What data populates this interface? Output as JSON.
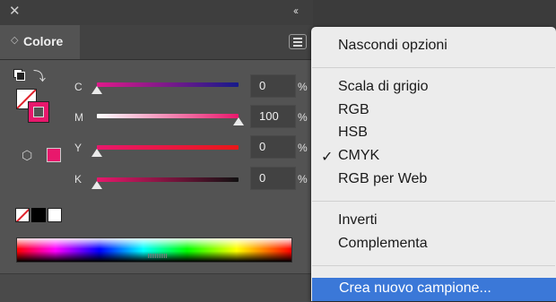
{
  "panel": {
    "title": "Colore",
    "sliders": [
      {
        "label": "C",
        "value": "0",
        "percent": 0,
        "unit": "%"
      },
      {
        "label": "M",
        "value": "100",
        "percent": 100,
        "unit": "%"
      },
      {
        "label": "Y",
        "value": "0",
        "percent": 0,
        "unit": "%"
      },
      {
        "label": "K",
        "value": "0",
        "percent": 0,
        "unit": "%"
      }
    ],
    "fill_color": "#e8186c"
  },
  "menu": {
    "items": {
      "hide_options": "Nascondi opzioni",
      "grayscale": "Scala di grigio",
      "rgb": "RGB",
      "hsb": "HSB",
      "cmyk": "CMYK",
      "web_rgb": "RGB per Web",
      "invert": "Inverti",
      "complement": "Complementa",
      "create_swatch": "Crea nuovo campione..."
    },
    "checked": "CMYK",
    "highlighted": "Crea nuovo campione...",
    "highlight_color": "#3b78d8"
  }
}
